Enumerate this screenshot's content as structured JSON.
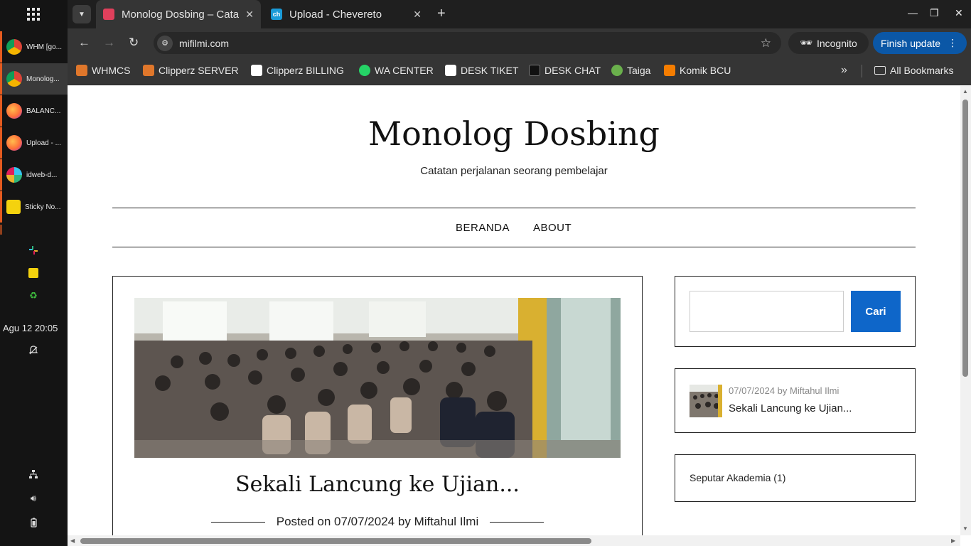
{
  "dock": {
    "apps": [
      {
        "label": "WHM [go...",
        "icon": "chrome-icon",
        "color": "#e34133"
      },
      {
        "label": "Monolog...",
        "icon": "chrome-icon",
        "color": "#e34133"
      },
      {
        "label": "BALANC...",
        "icon": "firefox-icon",
        "color": "#ff7139"
      },
      {
        "label": "Upload - ...",
        "icon": "firefox-icon",
        "color": "#ff7139"
      },
      {
        "label": "idweb-d...",
        "icon": "slack-icon",
        "color": "#ffffff"
      },
      {
        "label": "Sticky No...",
        "icon": "sticky-notes-icon",
        "color": "#f4d20e"
      }
    ],
    "tray_icons": [
      "slack-icon",
      "sticky-notes-icon",
      "recycle-icon"
    ],
    "clock": "Agu 12  20:05",
    "bottom_icons": [
      "notifications-off-icon",
      "network-icon",
      "volume-icon",
      "battery-icon"
    ]
  },
  "tabs": [
    {
      "title": "Monolog Dosbing – Cata",
      "active": true,
      "favicon_color": "#e0405c"
    },
    {
      "title": "Upload - Chevereto",
      "active": false,
      "favicon_color": "#1a9bd8",
      "favicon_text": "ch"
    }
  ],
  "toolbar": {
    "url": "mifilmi.com",
    "incognito_label": "Incognito",
    "finish_update_label": "Finish update"
  },
  "bookmarks": [
    {
      "label": "WHMCS",
      "color": "#e0772b"
    },
    {
      "label": "Clipperz SERVER",
      "color": "#e0772b"
    },
    {
      "label": "Clipperz BILLING",
      "color": "#ffffff"
    },
    {
      "label": "WA CENTER",
      "color": "#25d366"
    },
    {
      "label": "DESK TIKET",
      "color": "#ffffff"
    },
    {
      "label": "DESK CHAT",
      "color": "#111111"
    },
    {
      "label": "Taiga",
      "color": "#6ab04c"
    },
    {
      "label": "Komik BCU",
      "color": "#f57d00"
    }
  ],
  "all_bookmarks_label": "All Bookmarks",
  "site": {
    "title": "Monolog Dosbing",
    "tagline": "Catatan perjalanan seorang pembelajar",
    "menu": [
      "BERANDA",
      "ABOUT"
    ],
    "post": {
      "title": "Sekali Lancung ke Ujian...",
      "posted_on_label": "Posted on",
      "date": "07/07/2024",
      "by_label": "by",
      "author": "Miftahul Ilmi"
    },
    "search": {
      "button_label": "Cari",
      "placeholder": ""
    },
    "recent": {
      "meta": "07/07/2024 by Miftahul Ilmi",
      "title": "Sekali Lancung ke Ujian..."
    },
    "categories": [
      {
        "label": "Seputar Akademia (1)"
      }
    ]
  }
}
